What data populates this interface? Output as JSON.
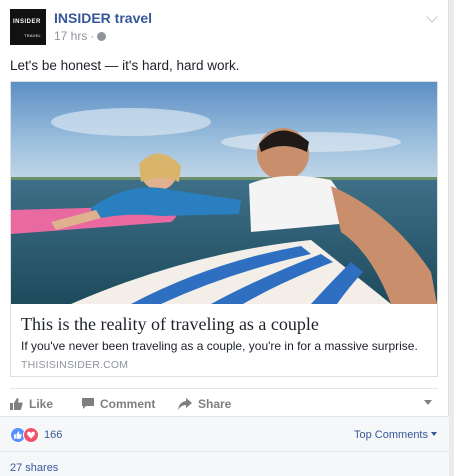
{
  "page": {
    "name": "INSIDER travel",
    "avatar_text_top": "INSIDER",
    "avatar_text_bottom": "TRAVEL",
    "timestamp": "17 hrs",
    "separator": "·"
  },
  "post": {
    "text": "Let's be honest — it's hard, hard work."
  },
  "link": {
    "title": "This is the reality of traveling as a couple",
    "description": "If you've never been traveling as a couple, you're in for a massive surprise.",
    "domain": "THISISINSIDER.COM"
  },
  "actions": {
    "like": "Like",
    "comment": "Comment",
    "share": "Share"
  },
  "reactions": {
    "count": "166",
    "top_comments": "Top Comments",
    "shares": "27 shares"
  },
  "colors": {
    "link_blue": "#365899",
    "like_blue": "#5890ff",
    "love_red": "#f25268"
  }
}
